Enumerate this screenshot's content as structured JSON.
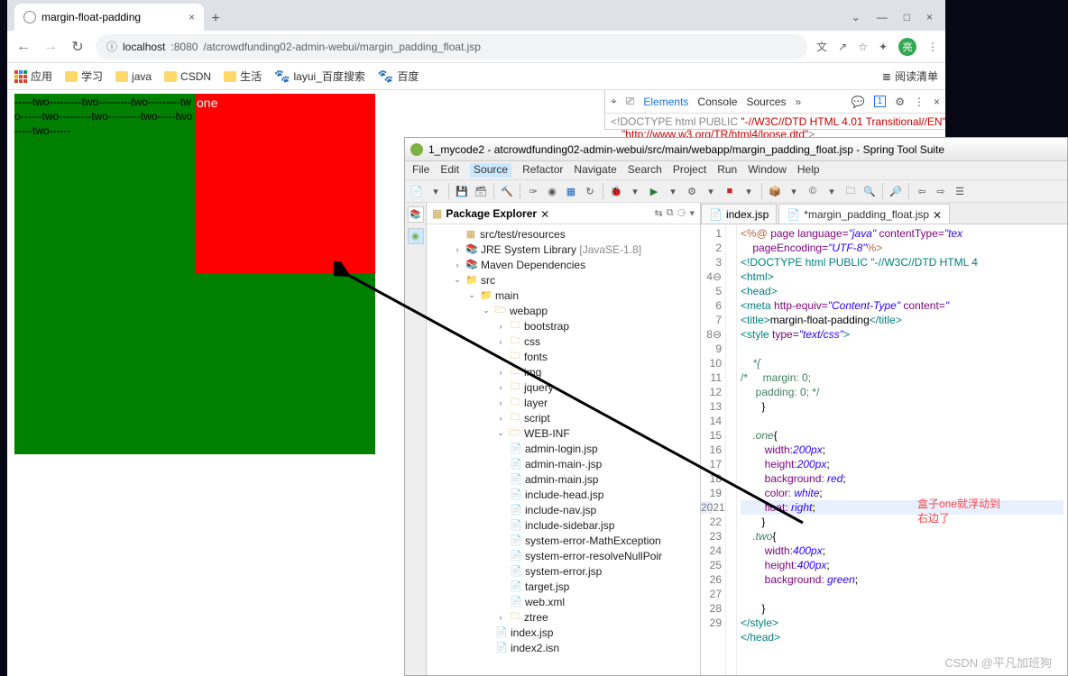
{
  "browser": {
    "tab_title": "margin-float-padding",
    "new_tab": "+",
    "win": {
      "min": "—",
      "max": "□",
      "close": "×",
      "down": "⌄"
    },
    "nav": {
      "back": "←",
      "fwd": "→",
      "reload": "↻"
    },
    "url_icon": "ⓘ",
    "url_host": "localhost",
    "url_port": ":8080",
    "url_path": "/atcrowdfunding02-admin-webui/margin_padding_float.jsp",
    "addr_actions": {
      "translate": "文",
      "share": "↗",
      "star": "☆",
      "ext": "✦",
      "avatar": "亮",
      "menu": "⋮"
    },
    "bookmarks": {
      "apps": "应用",
      "study": "学习",
      "java": "java",
      "csdn": "CSDN",
      "life": "生活",
      "layui": "layui_百度搜索",
      "baidu": "百度",
      "reading": "阅读清单",
      "list_icon": "≣"
    }
  },
  "page": {
    "one": "one",
    "two_text": "-----two---------two---------two---------two------two---------two---------two-----two-----two------"
  },
  "devtools": {
    "inspect": "⌖",
    "device": "⎚",
    "tabs": {
      "elements": "Elements",
      "console": "Console",
      "sources": "Sources",
      "more": "»"
    },
    "msg": "1",
    "gear": "⚙",
    "dots": "⋮",
    "close": "×",
    "doctype_a": "<!DOCTYPE html PUBLIC ",
    "doctype_b": "\"-//W3C//DTD HTML 4.01 Transitional//EN\"",
    "doctype_c": "\"http://www.w3.org/TR/html4/loose.dtd\"",
    "doctype_d": ">"
  },
  "eclipse": {
    "title": "1_mycode2 - atcrowdfunding02-admin-webui/src/main/webapp/margin_padding_float.jsp - Spring Tool Suite",
    "menu": {
      "file": "File",
      "edit": "Edit",
      "source": "Source",
      "refactor": "Refactor",
      "navigate": "Navigate",
      "search": "Search",
      "project": "Project",
      "run": "Run",
      "window": "Window",
      "help": "Help"
    },
    "pkg": {
      "title": "Package Explorer",
      "close": "⨯"
    },
    "tree": {
      "srcTestRes": "src/test/resources",
      "jre": "JRE System Library",
      "jre_extra": "[JavaSE-1.8]",
      "maven": "Maven Dependencies",
      "src": "src",
      "main": "main",
      "webapp": "webapp",
      "bootstrap": "bootstrap",
      "css": "css",
      "fonts": "fonts",
      "img": "img",
      "jquery": "jquery",
      "layer": "layer",
      "script": "script",
      "webinf": "WEB-INF",
      "f1": "admin-login.jsp",
      "f2": "admin-main-.jsp",
      "f3": "admin-main.jsp",
      "f4": "include-head.jsp",
      "f5": "include-nav.jsp",
      "f6": "include-sidebar.jsp",
      "f7": "system-error-MathException",
      "f8": "system-error-resolveNullPoir",
      "f9": "system-error.jsp",
      "f10": "target.jsp",
      "f11": "web.xml",
      "ztree": "ztree",
      "idx": "index.jsp",
      "idx2": "index2.isn"
    },
    "tabs": {
      "index": "index.jsp",
      "margin": "*margin_padding_float.jsp",
      "close": "⨯"
    },
    "code": {
      "l1a": "<%@",
      "l1b": " page ",
      "l1c": "language=",
      "l1d": "\"java\"",
      "l1e": " contentType=",
      "l1f": "\"tex",
      "l2a": "pageEncoding=",
      "l2b": "\"UTF-8\"",
      "l2c": "%>",
      "l3a": "<!DOCTYPE",
      "l3b": " html ",
      "l3c": "PUBLIC ",
      "l3d": "\"-//W3C//DTD HTML 4",
      "l4": "<html>",
      "l5": "<head>",
      "l6a": "<meta ",
      "l6b": "http-equiv=",
      "l6c": "\"Content-Type\"",
      "l6d": " content=",
      "l6e": "\"",
      "l7a": "<title>",
      "l7b": "margin-float-padding",
      "l7c": "</title>",
      "l8a": "<style ",
      "l8b": "type=",
      "l8c": "\"text/css\"",
      "l8d": ">",
      "l10": "*{",
      "l11a": "/*",
      "l11b": "     margin: 0;",
      "l12": "     padding: 0; */",
      "l13": "   }",
      "l15": ".one",
      "l15b": "{",
      "l16a": "width:",
      "l16b": "200px",
      "l16c": ";",
      "l17a": "height:",
      "l17b": "200px",
      "l17c": ";",
      "l18a": "background:",
      "l18b": " red",
      "l18c": ";",
      "l19a": "color:",
      "l19b": " white",
      "l19c": ";",
      "l20a": "float:",
      "l20b": " right",
      "l20c": ";",
      "l21": "   }",
      "l22": ".two",
      "l22b": "{",
      "l23a": "width:",
      "l23b": "400px",
      "l23c": ";",
      "l24a": "height:",
      "l24b": "400px",
      "l24c": ";",
      "l25a": "background:",
      "l25b": " green",
      "l25c": ";",
      "l27": "   }",
      "l28": "</style>",
      "l29": "</head>"
    },
    "annotation": {
      "line1": "盒子one就浮动到",
      "line2": "右边了"
    }
  },
  "watermark": "CSDN @平凡加班狗"
}
